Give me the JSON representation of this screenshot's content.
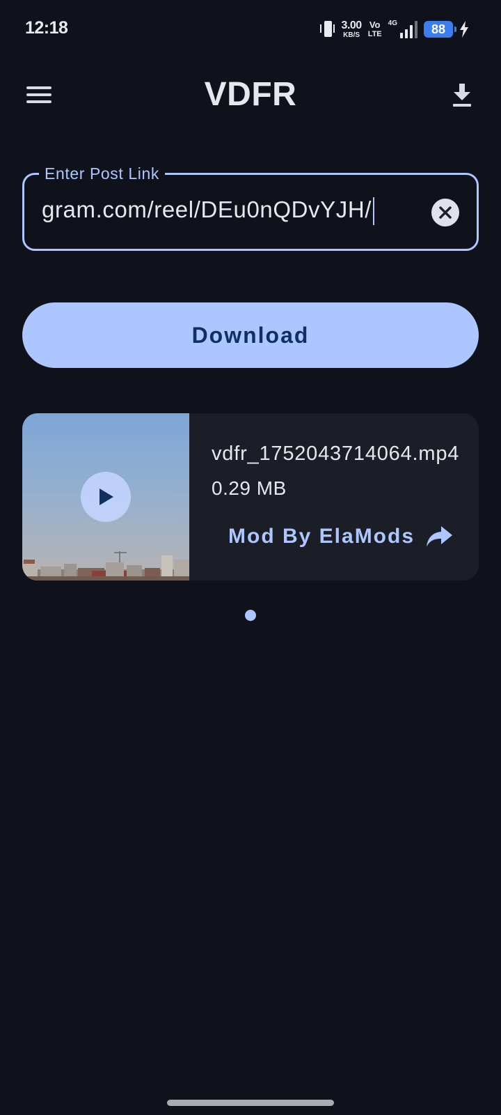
{
  "status_bar": {
    "time": "12:18",
    "net_speed_value": "3.00",
    "net_speed_unit": "KB/S",
    "volte_top": "Vo",
    "volte_bottom": "LTE",
    "network_type": "4G",
    "battery_level": "88",
    "icons": [
      "vibrate-icon",
      "signal-icon",
      "battery-icon",
      "charging-bolt-icon"
    ]
  },
  "app_bar": {
    "title": "VDFR",
    "icons": [
      "menu-icon",
      "download-icon"
    ]
  },
  "link_input": {
    "label": "Enter Post Link",
    "value": "gram.com/reel/DEu0nQDvYJH/",
    "icons": [
      "clear-icon"
    ]
  },
  "download_button": {
    "label": "Download"
  },
  "media_card": {
    "file_name": "vdfr_1752043714064.mp4",
    "file_size": "0.29 MB",
    "mod_label": "Mod By ElaMods",
    "icons": [
      "play-icon",
      "share-icon"
    ]
  },
  "pager": {
    "page_count": 1,
    "current_page": 1
  },
  "colors": {
    "background": "#0f121a",
    "accent": "#aec6ff",
    "card": "#1b1e27",
    "button_text": "#10305f",
    "battery": "#3b7ef0"
  }
}
